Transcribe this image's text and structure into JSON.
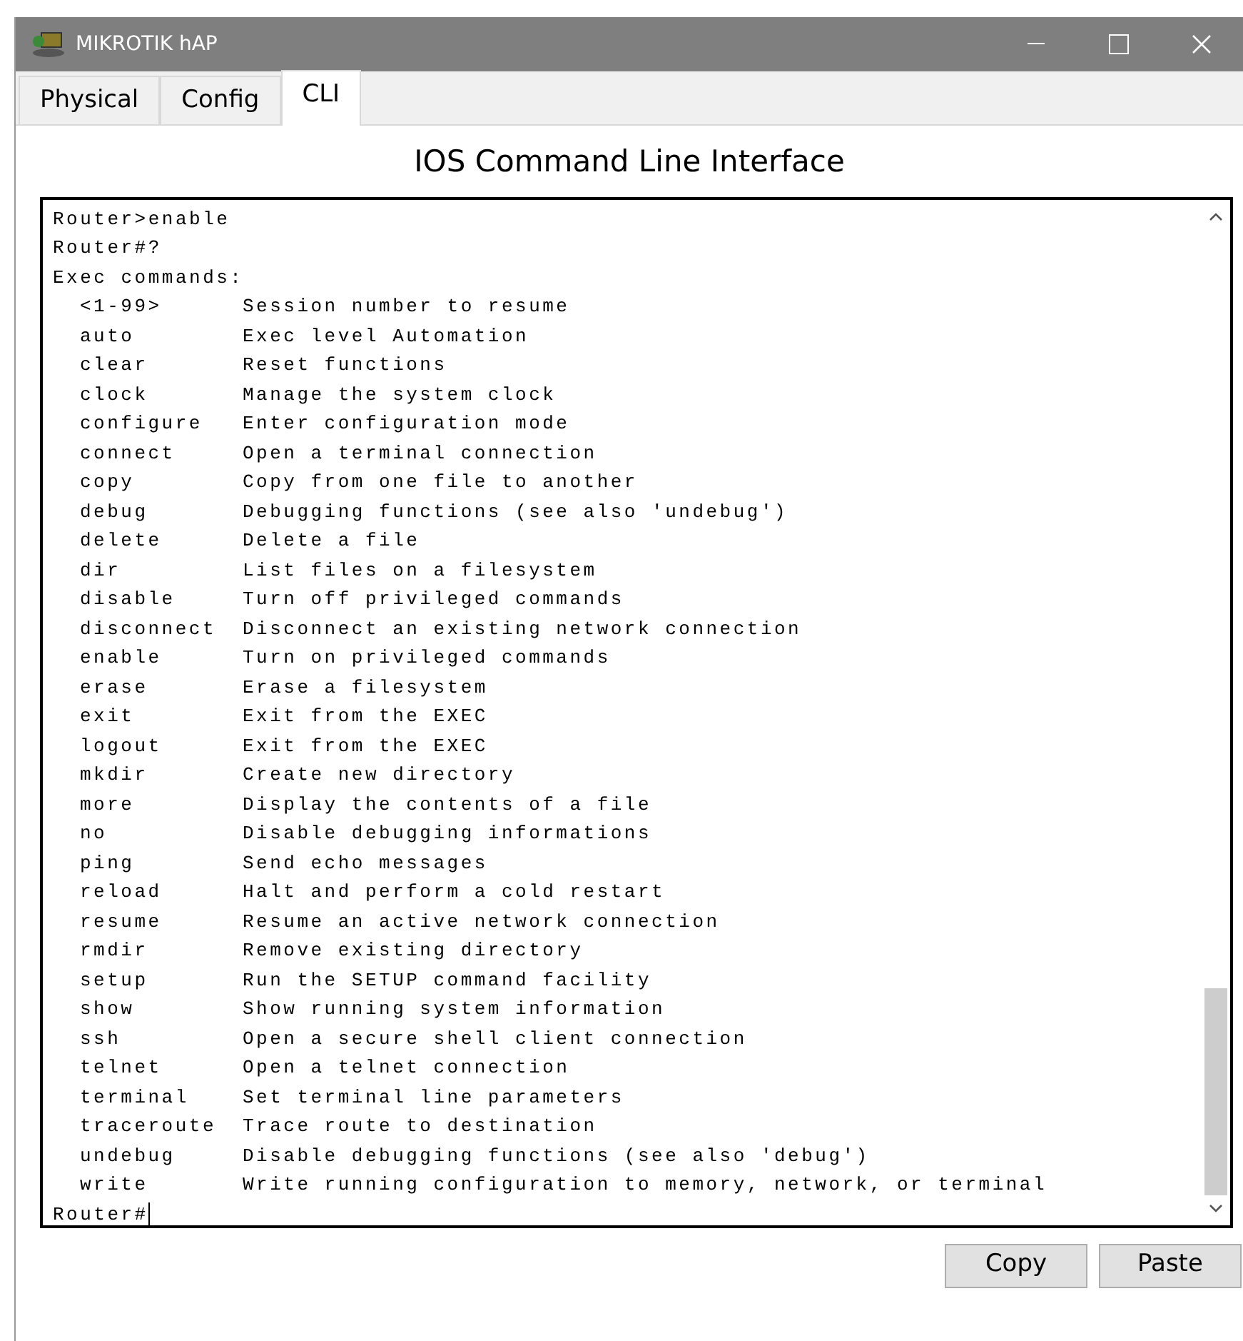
{
  "window": {
    "title": "MIKROTIK hAP"
  },
  "tabs": [
    {
      "label": "Physical",
      "selected": false
    },
    {
      "label": "Config",
      "selected": false
    },
    {
      "label": "CLI",
      "selected": true
    }
  ],
  "heading": "IOS Command Line Interface",
  "terminal": {
    "lines_before": [
      "Router>enable",
      "Router#?",
      "Exec commands:"
    ],
    "commands": [
      {
        "command": "<1-99>",
        "description": "Session number to resume"
      },
      {
        "command": "auto",
        "description": "Exec level Automation"
      },
      {
        "command": "clear",
        "description": "Reset functions"
      },
      {
        "command": "clock",
        "description": "Manage the system clock"
      },
      {
        "command": "configure",
        "description": "Enter configuration mode"
      },
      {
        "command": "connect",
        "description": "Open a terminal connection"
      },
      {
        "command": "copy",
        "description": "Copy from one file to another"
      },
      {
        "command": "debug",
        "description": "Debugging functions (see also 'undebug')"
      },
      {
        "command": "delete",
        "description": "Delete a file"
      },
      {
        "command": "dir",
        "description": "List files on a filesystem"
      },
      {
        "command": "disable",
        "description": "Turn off privileged commands"
      },
      {
        "command": "disconnect",
        "description": "Disconnect an existing network connection"
      },
      {
        "command": "enable",
        "description": "Turn on privileged commands"
      },
      {
        "command": "erase",
        "description": "Erase a filesystem"
      },
      {
        "command": "exit",
        "description": "Exit from the EXEC"
      },
      {
        "command": "logout",
        "description": "Exit from the EXEC"
      },
      {
        "command": "mkdir",
        "description": "Create new directory"
      },
      {
        "command": "more",
        "description": "Display the contents of a file"
      },
      {
        "command": "no",
        "description": "Disable debugging informations"
      },
      {
        "command": "ping",
        "description": "Send echo messages"
      },
      {
        "command": "reload",
        "description": "Halt and perform a cold restart"
      },
      {
        "command": "resume",
        "description": "Resume an active network connection"
      },
      {
        "command": "rmdir",
        "description": "Remove existing directory"
      },
      {
        "command": "setup",
        "description": "Run the SETUP command facility"
      },
      {
        "command": "show",
        "description": "Show running system information"
      },
      {
        "command": "ssh",
        "description": "Open a secure shell client connection"
      },
      {
        "command": "telnet",
        "description": "Open a telnet connection"
      },
      {
        "command": "terminal",
        "description": "Set terminal line parameters"
      },
      {
        "command": "traceroute",
        "description": "Trace route to destination"
      },
      {
        "command": "undebug",
        "description": "Disable debugging functions (see also 'debug')"
      },
      {
        "command": "write",
        "description": "Write running configuration to memory, network, or terminal"
      }
    ],
    "prompt": "Router#"
  },
  "buttons": [
    "Copy",
    "Paste"
  ]
}
